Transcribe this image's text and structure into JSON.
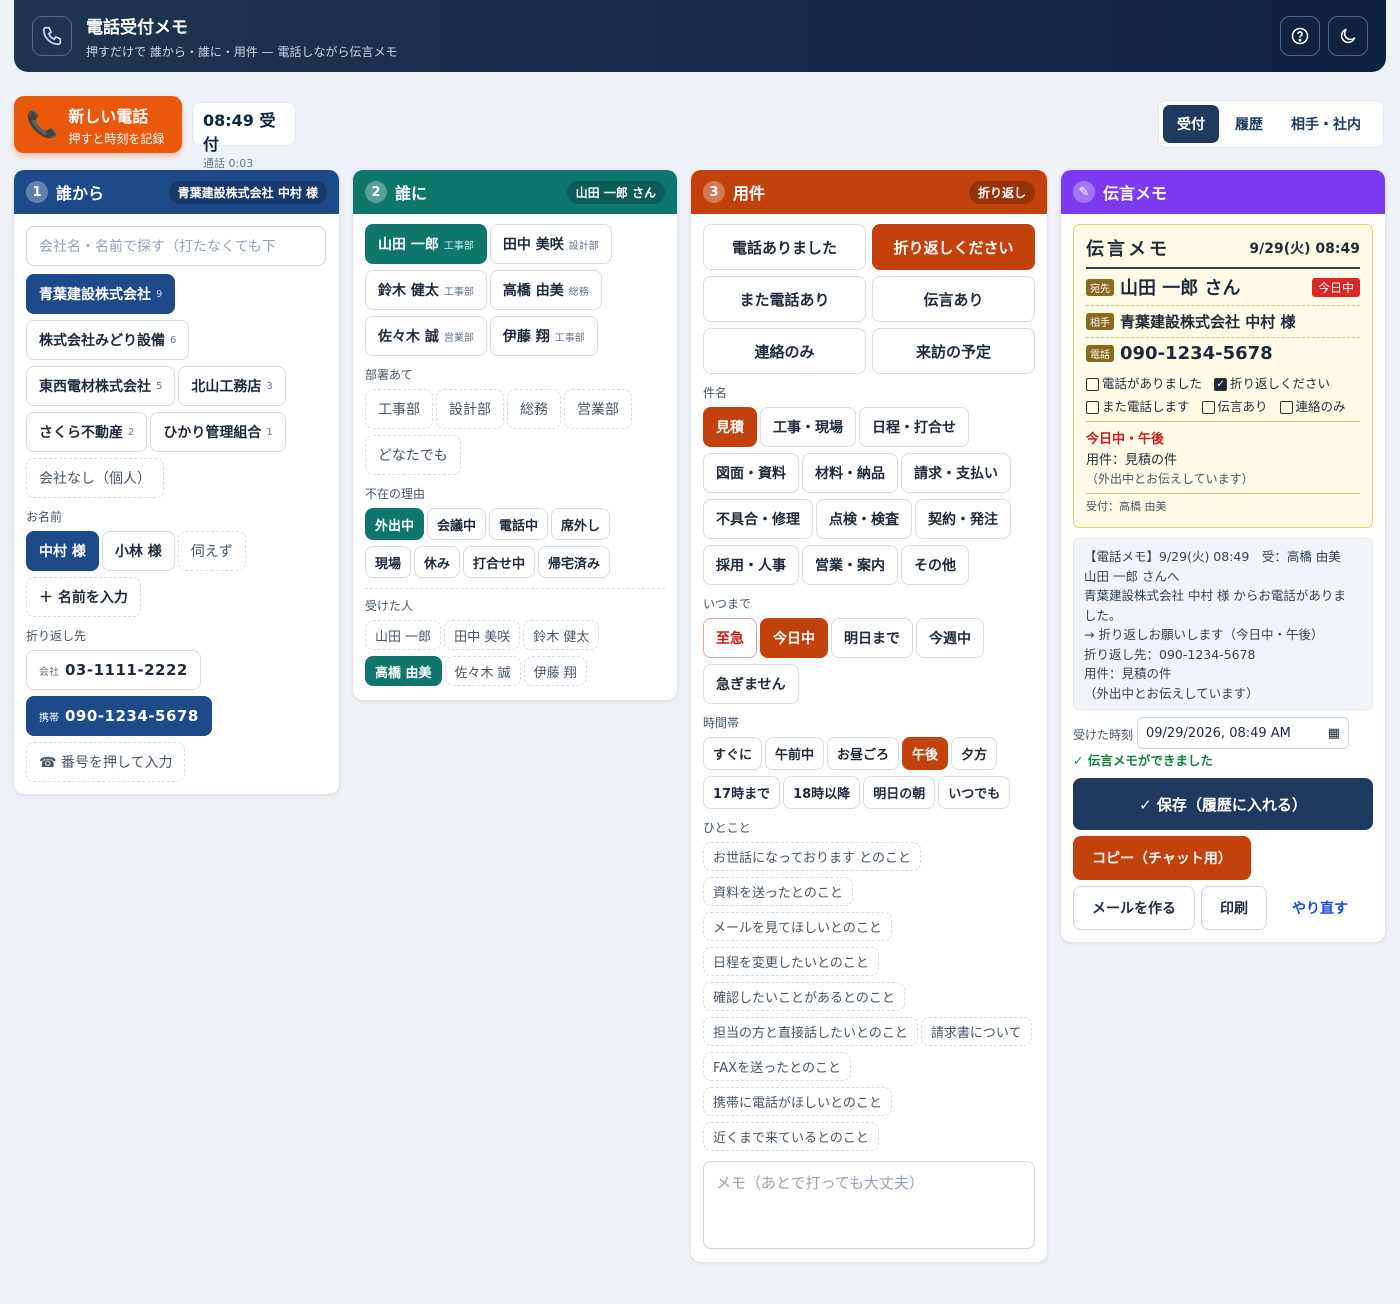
{
  "header": {
    "title": "電話受付メモ",
    "subtitle": "押すだけで 誰から・誰に・用件 — 電話しながら伝言メモ"
  },
  "newcall": {
    "label": "新しい電話",
    "sub": "押すと時刻を記録"
  },
  "clock": {
    "time": "08:49 受付",
    "duration": "通話 0:03"
  },
  "tabs": [
    "受付",
    "履歴",
    "相手・社内"
  ],
  "from": {
    "num": "1",
    "title": "誰から",
    "pill": "青葉建設株式会社 中村 様",
    "search_placeholder": "会社名・名前で探す（打たなくても下",
    "companies": [
      {
        "name": "青葉建設株式会社",
        "count": "9"
      },
      {
        "name": "株式会社みどり設備",
        "count": "6"
      },
      {
        "name": "東西電材株式会社",
        "count": "5"
      },
      {
        "name": "北山工務店",
        "count": "3"
      },
      {
        "name": "さくら不動産",
        "count": "2"
      },
      {
        "name": "ひかり管理組合",
        "count": "1"
      }
    ],
    "no_company": "会社なし（個人）",
    "name_label": "お名前",
    "names": [
      "中村 様",
      "小林 様"
    ],
    "unknown": "伺えず",
    "add_name": "＋ 名前を入力",
    "callback_label": "折り返し先",
    "office_tag": "会社",
    "office_num": "03-1111-2222",
    "mobile_tag": "携帯",
    "mobile_num": "090-1234-5678",
    "dial": "☎ 番号を押して入力"
  },
  "to": {
    "num": "2",
    "title": "誰に",
    "pill": "山田 一郎 さん",
    "people": [
      {
        "name": "山田 一郎",
        "dept": "工事部"
      },
      {
        "name": "田中 美咲",
        "dept": "設計部"
      },
      {
        "name": "鈴木 健太",
        "dept": "工事部"
      },
      {
        "name": "高橋 由美",
        "dept": "総務"
      },
      {
        "name": "佐々木 誠",
        "dept": "営業部"
      },
      {
        "name": "伊藤 翔",
        "dept": "工事部"
      }
    ],
    "dept_label": "部署あて",
    "depts": [
      "工事部",
      "設計部",
      "総務",
      "営業部",
      "どなたでも"
    ],
    "absence_label": "不在の理由",
    "absences": [
      "外出中",
      "会議中",
      "電話中",
      "席外し",
      "現場",
      "休み",
      "打合せ中",
      "帰宅済み"
    ],
    "receiver_label": "受けた人",
    "receivers": [
      "山田 一郎",
      "田中 美咲",
      "鈴木 健太",
      "高橋 由美",
      "佐々木 誠",
      "伊藤 翔"
    ]
  },
  "matter": {
    "num": "3",
    "title": "用件",
    "pill": "折り返し",
    "actions": [
      "電話ありました",
      "折り返しください",
      "また電話あり",
      "伝言あり",
      "連絡のみ",
      "来訪の予定"
    ],
    "subject_label": "件名",
    "subjects": [
      "見積",
      "工事・現場",
      "日程・打合せ",
      "図面・資料",
      "材料・納品",
      "請求・支払い",
      "不具合・修理",
      "点検・検査",
      "契約・発注",
      "採用・人事",
      "営業・案内",
      "その他"
    ],
    "due_label": "いつまで",
    "dues": [
      "至急",
      "今日中",
      "明日まで",
      "今週中",
      "急ぎません"
    ],
    "time_label": "時間帯",
    "times": [
      "すぐに",
      "午前中",
      "お昼ごろ",
      "午後",
      "夕方",
      "17時まで",
      "18時以降",
      "明日の朝",
      "いつでも"
    ],
    "note_label": "ひとこと",
    "notes": [
      "お世話になっております とのこと",
      "資料を送ったとのこと",
      "メールを見てほしいとのこと",
      "日程を変更したいとのこと",
      "確認したいことがあるとのこと",
      "担当の方と直接話したいとのこと",
      "請求書について",
      "FAXを送ったとのこと",
      "携帯に電話がほしいとのこと",
      "近くまで来ているとのこと"
    ],
    "memo_placeholder": "メモ（あとで打っても大丈夫）"
  },
  "memo": {
    "title": "伝言メモ",
    "card_title": "伝言メモ",
    "datetime": "9/29(火) 08:49",
    "to_tag": "宛先",
    "to": "山田 一郎 さん",
    "urgent": "今日中",
    "from_tag": "相手",
    "from": "青葉建設株式会社 中村 様",
    "tel_tag": "電話",
    "tel": "090-1234-5678",
    "checks": [
      {
        "label": "電話がありました",
        "on": false
      },
      {
        "label": "折り返しください",
        "on": true
      },
      {
        "label": "また電話します",
        "on": false
      },
      {
        "label": "伝言あり",
        "on": false
      },
      {
        "label": "連絡のみ",
        "on": false
      }
    ],
    "due": "今日中・午後",
    "subject": "用件：見積の件",
    "status": "（外出中とお伝えしています）",
    "received": "受付：高橋 由美",
    "text": [
      "【電話メモ】9/29(火) 08:49　受：高橋 由美",
      "山田 一郎 さんへ",
      "青葉建設株式会社 中村 様 からお電話がありま",
      "した。",
      "→ 折り返しお願いします（今日中・午後）",
      "折り返し先：090-1234-5678",
      "用件：見積の件",
      "（外出中とお伝えしています）"
    ],
    "time_label": "受けた時刻",
    "time_value": "09/29/2026, 08:49 AM",
    "done": "✓ 伝言メモができました",
    "save": "✓ 保存（履歴に入れる）",
    "copy": "コピー（チャット用）",
    "mail": "メールを作る",
    "print": "印刷",
    "redo": "やり直す"
  },
  "colors": {
    "blue": "#1e4a8a",
    "teal": "#0f766e",
    "orange": "#c2410c",
    "purple": "#7e3af2"
  }
}
